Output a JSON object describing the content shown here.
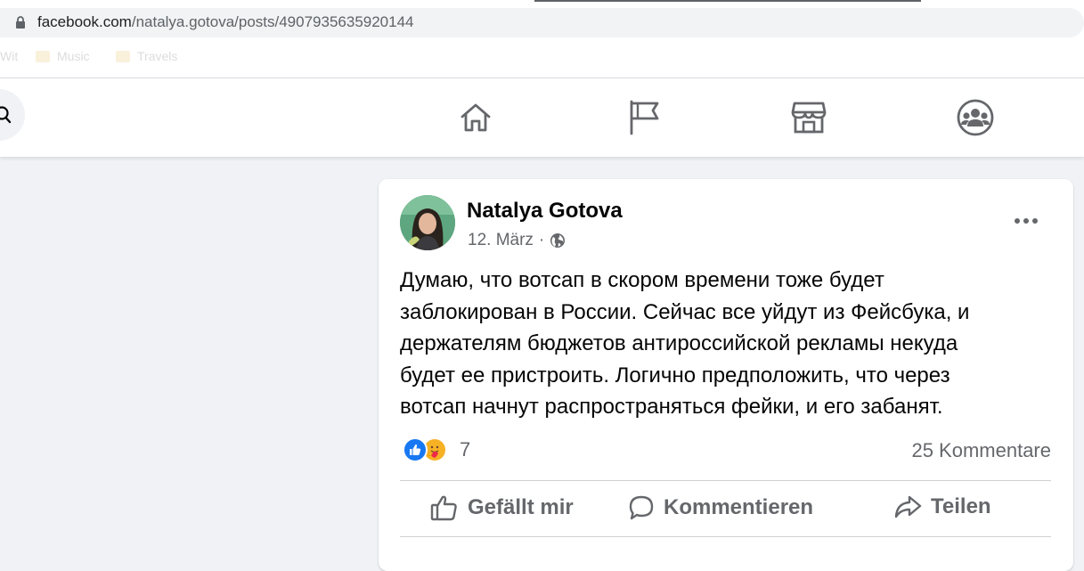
{
  "browser": {
    "url_domain": "facebook.com",
    "url_path": "/natalya.gotova/posts/4907935635920144",
    "bookmarks": [
      "Wit",
      "Music",
      "Travels"
    ]
  },
  "nav": {
    "icons": [
      "home-icon",
      "pages-flag-icon",
      "marketplace-icon",
      "groups-icon"
    ]
  },
  "post": {
    "author": "Natalya Gotova",
    "date": "12. März",
    "separator": "·",
    "privacy_icon": "globe-icon",
    "text_lines": [
      "Думаю, что вотсап в скором времени тоже будет",
      "заблокирован в России. Сейчас все уйдут из Фейсбука, и",
      "держателям бюджетов антироссийской рекламы некуда",
      "будет ее пристроить. Логично предположить, что через",
      "вотсап начнут распространяться фейки, и его забанят."
    ],
    "reactions": {
      "types": [
        "like",
        "care"
      ],
      "count": "7"
    },
    "comments": "25 Kommentare",
    "actions": {
      "like": "Gefällt mir",
      "comment": "Kommentieren",
      "share": "Teilen"
    }
  },
  "colors": {
    "brand_blue": "#1877f2",
    "secondary_text": "#65676b",
    "background": "#f0f2f5"
  }
}
